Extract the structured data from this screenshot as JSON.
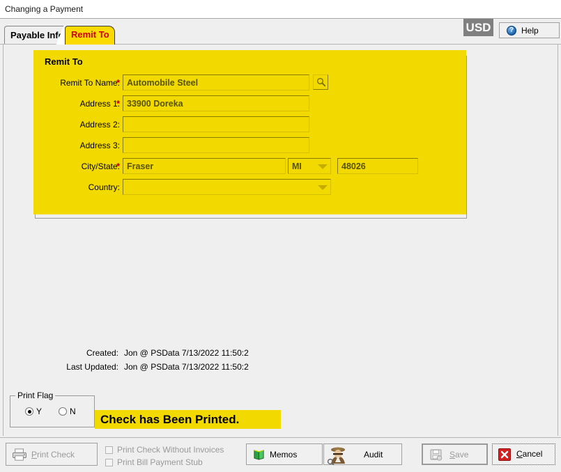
{
  "window": {
    "title": "Changing a Payment"
  },
  "header": {
    "currency_badge": "USD",
    "help_label": "Help",
    "help_icon": "question-circle-icon"
  },
  "tabs": [
    {
      "label": "Payable Info",
      "active": false
    },
    {
      "label": "Remit To",
      "active": true
    }
  ],
  "remit_to": {
    "legend": "Remit To",
    "lookup_icon": "magnifier-icon",
    "fields": [
      {
        "label": "Remit To Name:",
        "required": true,
        "value": "Automobile Steel"
      },
      {
        "label": "Address 1:",
        "required": true,
        "value": "33900 Doreka"
      },
      {
        "label": "Address 2:",
        "required": false,
        "value": ""
      },
      {
        "label": "Address 3:",
        "required": false,
        "value": ""
      }
    ],
    "city_state": {
      "label": "City/State:",
      "required": true,
      "city": "Fraser",
      "state": "MI",
      "zip": "48026"
    },
    "country": {
      "label": "Country:",
      "value": ""
    }
  },
  "audit_stamp": {
    "created_label": "Created:",
    "created_value": "Jon @ PSData 7/13/2022 11:50:2",
    "updated_label": "Last Updated:",
    "updated_value": "Jon @ PSData 7/13/2022 11:50:2"
  },
  "print_flag": {
    "legend": "Print Flag",
    "options": [
      {
        "label": "Y",
        "selected": true
      },
      {
        "label": "N",
        "selected": false
      }
    ],
    "banner": "Check has Been Printed."
  },
  "bottom_bar": {
    "print_check": {
      "label": "Print Check",
      "icon": "printer-icon",
      "disabled": true
    },
    "checkboxes": [
      {
        "label": "Print Check Without Invoices",
        "checked": false,
        "disabled": true
      },
      {
        "label": "Print Bill Payment Stub",
        "checked": false,
        "disabled": true
      }
    ],
    "memos": {
      "label": "Memos",
      "icon": "book-icon"
    },
    "audit": {
      "label": "Audit",
      "icon": "detective-icon"
    },
    "save": {
      "label": "Save",
      "icon": "floppy-disk-icon",
      "disabled": true
    },
    "cancel": {
      "label": "Cancel",
      "icon": "red-x-icon"
    }
  },
  "colors": {
    "accent_yellow": "#f2d900",
    "tab_active_text": "#cc0000",
    "required_star": "#cc0000",
    "badge_bg": "#808080"
  }
}
